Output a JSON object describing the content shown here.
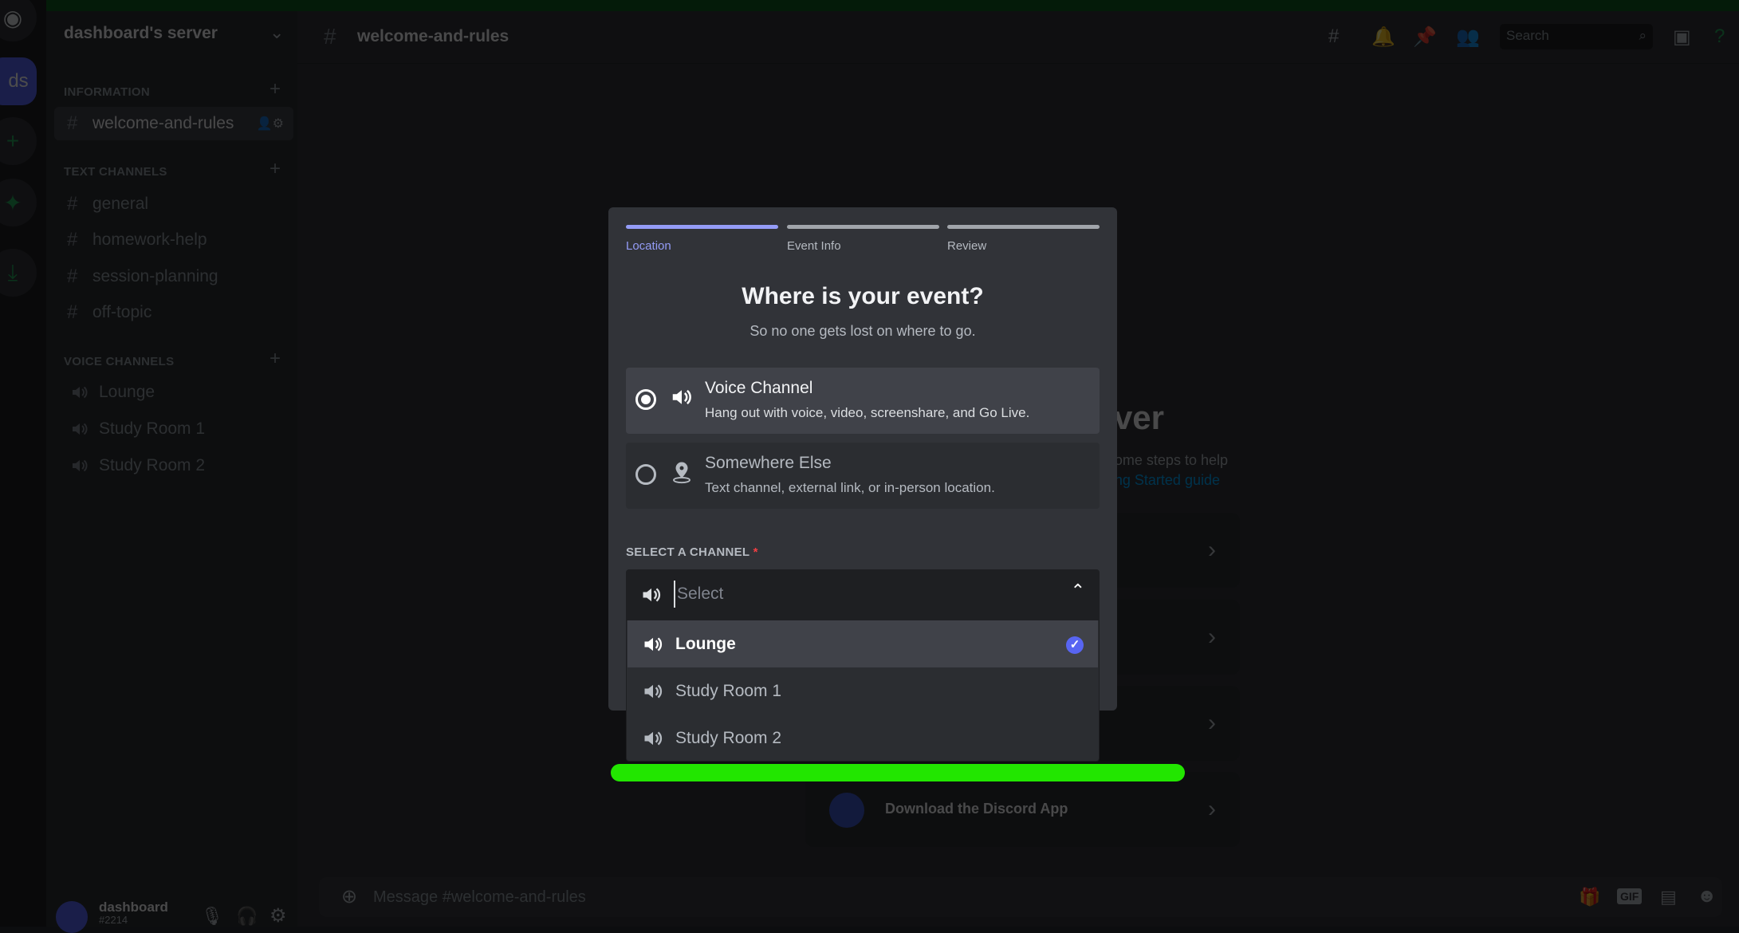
{
  "server": {
    "name": "dashboard's server",
    "rail_partial_label": "ds"
  },
  "sidebar": {
    "categories": [
      {
        "name": "INFORMATION",
        "channels": [
          {
            "name": "welcome-and-rules",
            "type": "text",
            "active": true
          }
        ]
      },
      {
        "name": "TEXT CHANNELS",
        "channels": [
          {
            "name": "general"
          },
          {
            "name": "homework-help"
          },
          {
            "name": "session-planning"
          },
          {
            "name": "off-topic"
          }
        ]
      },
      {
        "name": "VOICE CHANNELS",
        "channels": [
          {
            "name": "Lounge"
          },
          {
            "name": "Study Room 1"
          },
          {
            "name": "Study Room 2"
          }
        ]
      }
    ]
  },
  "user": {
    "name": "dashboard",
    "tag": "#2214"
  },
  "header": {
    "channel": "welcome-and-rules",
    "search_placeholder": "Search"
  },
  "background": {
    "heading_fragment": "ver",
    "text_fragment": "ome steps to help",
    "link_fragment": "ng Started guide",
    "download_app": "Download the Discord App",
    "message_placeholder": "Message #welcome-and-rules",
    "gif_label": "GIF"
  },
  "modal": {
    "steps": [
      {
        "label": "Location",
        "active": true
      },
      {
        "label": "Event Info",
        "active": false
      },
      {
        "label": "Review",
        "active": false
      }
    ],
    "title": "Where is your event?",
    "subtitle": "So no one gets lost on where to go.",
    "options": [
      {
        "title": "Voice Channel",
        "desc": "Hang out with voice, video, screenshare, and Go Live.",
        "selected": true,
        "icon": "speaker-icon"
      },
      {
        "title": "Somewhere Else",
        "desc": "Text channel, external link, or in-person location.",
        "selected": false,
        "icon": "location-pin-icon"
      }
    ],
    "select_label": "SELECT A CHANNEL",
    "required_mark": "*",
    "select_placeholder": "Select",
    "dropdown": [
      {
        "name": "Lounge",
        "selected": true
      },
      {
        "name": "Study Room 1",
        "selected": false
      },
      {
        "name": "Study Room 2",
        "selected": false
      }
    ]
  },
  "colors": {
    "accent": "#5865f2",
    "step_active": "#949cf7",
    "annotation_green": "#22e600"
  }
}
